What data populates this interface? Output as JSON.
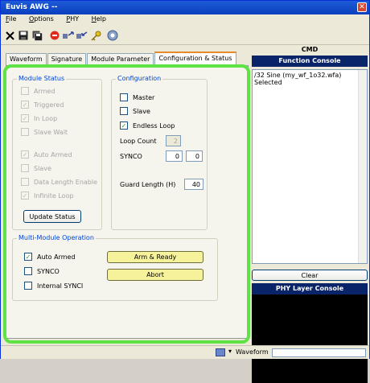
{
  "window": {
    "title": "Euvis AWG --",
    "close_glyph": "✕"
  },
  "menu": [
    {
      "label": "File",
      "key": "F",
      "rest": "ile"
    },
    {
      "label": "Options",
      "key": "O",
      "rest": "ptions"
    },
    {
      "label": "PHY",
      "key": "P",
      "rest": "HY"
    },
    {
      "label": "Help",
      "key": "H",
      "rest": "elp"
    }
  ],
  "toolbar": [
    "close-icon",
    "save-icon",
    "save-all-icon",
    "stop-icon",
    "send-icon",
    "receive-icon",
    "key-icon",
    "settings-icon"
  ],
  "tabs": [
    "Waveform",
    "Signature",
    "Module Parameter",
    "Configuration & Status"
  ],
  "active_tab": "Configuration & Status",
  "module_status": {
    "title": "Module Status",
    "armed": "Armed",
    "triggered": "Triggered",
    "in_loop": "In Loop",
    "slave_wait": "Slave Wait",
    "auto_armed": "Auto Armed",
    "slave": "Slave",
    "data_length_enable": "Data Length Enable",
    "infinite_loop": "Infinite Loop",
    "update_button": "Update Status"
  },
  "configuration": {
    "title": "Configuration",
    "master": "Master",
    "slave": "Slave",
    "endless_loop": "Endless Loop",
    "loop_count_label": "Loop Count",
    "loop_count_value": "2",
    "synco_label": "SYNCO",
    "synco_a": "0",
    "synco_b": "0",
    "guard_length_label": "Guard Length (H)",
    "guard_length_value": "40"
  },
  "multi_module": {
    "title": "Multi-Module Operation",
    "auto_armed": "Auto Armed",
    "synco": "SYNCO",
    "internal_synci": "Internal SYNCI",
    "arm_ready_button": "Arm & Ready",
    "abort_button": "Abort"
  },
  "right_panel": {
    "cmd_label": "CMD",
    "function_console_title": "Function Console",
    "console_lines": [
      "/32 Sine (my_wf_1o32.wfa)",
      "Selected"
    ],
    "clear_button": "Clear",
    "phy_console_title": "PHY Layer Console"
  },
  "statusbar": {
    "waveform_label": "Waveform"
  },
  "colors": {
    "highlight": "#5ee245",
    "title_bar": "#0a3fbf",
    "console_header": "#0a246a",
    "yellow_button": "#f6f29c"
  }
}
